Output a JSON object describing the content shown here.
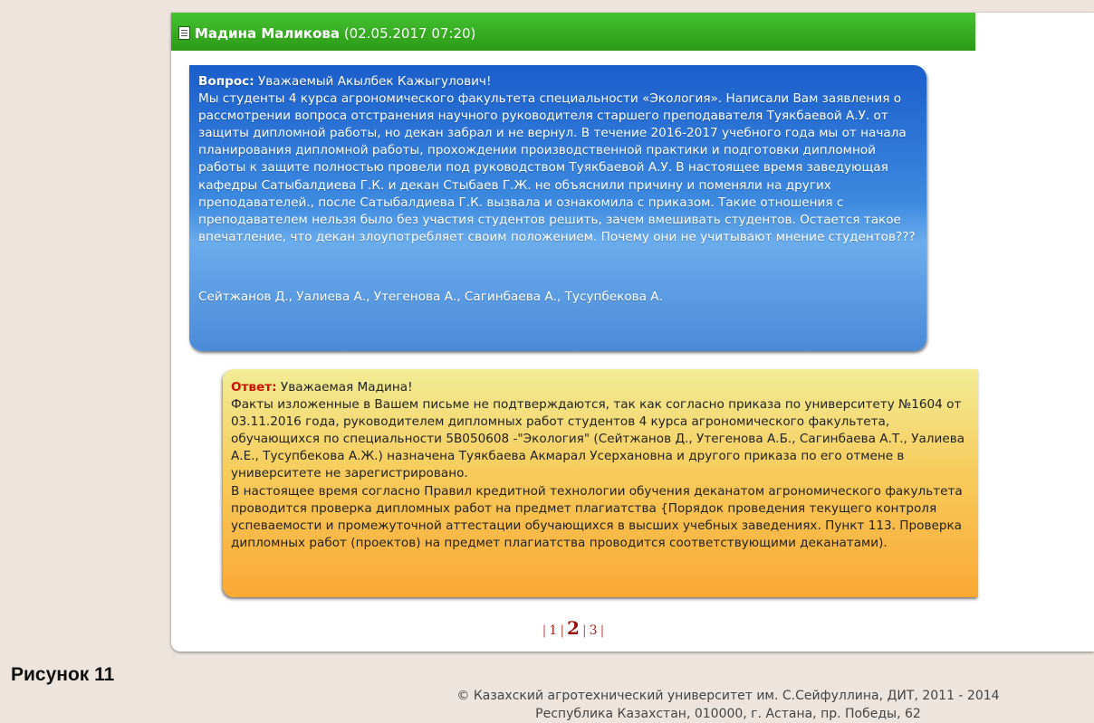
{
  "header": {
    "author": "Мадина Маликова",
    "datetime": "(02.05.2017 07:20)"
  },
  "question": {
    "label": "Вопрос:",
    "greeting": "Уважаемый Акылбек Кажыгулович!",
    "body": "Мы студенты 4 курса агрономического факультета специальности «Экология». Написали Вам заявления о рассмотрении вопроса отстранения научного руководителя старшего преподавателя Туякбаевой А.У. от защиты дипломной работы, но декан забрал и не вернул. В течение 2016-2017 учебного года мы от начала планирования дипломной работы, прохождении производственной практики и подготовки дипломной работы к защите полностью провели под руководством Туякбаевой А.У. В настоящее время заведующая кафедры Сатыбалдиева Г.К. и декан Стыбаев Г.Ж. не объяснили причину и поменяли на других преподавателей., после Сатыбалдиева Г.К. вызвала и ознакомила с приказом. Такие отношения с преподавателем нельзя было без участия студентов решить, зачем вмешивать студентов. Остается такое впечатление, что декан злоупотребляет своим положением. Почему они не учитывают мнение студентов???",
    "signature": "Сейтжанов Д., Уалиева А., Утегенова А., Сагинбаева А., Тусупбекова А."
  },
  "answer": {
    "label": "Ответ:",
    "greeting": "Уважаемая Мадина!",
    "paragraph1": "Факты изложенные в Вашем письме не подтверждаются, так как согласно приказа по университету №1604 от 03.11.2016 года, руководителем дипломных работ студентов 4 курса агрономического факультета, обучающихся по специальности 5В050608 -\"Экология\" (Сейтжанов Д., Утегенова А.Б., Сагинбаева А.Т., Уалиева А.Е., Тусупбекова А.Ж.) назначена Туякбаева Акмарал Усерхановна и другого приказа по его отмене в университете не зарегистрировано.",
    "paragraph2": "В настоящее время согласно Правил кредитной технологии обучения деканатом агрономического факультета проводится проверка дипломных работ на предмет плагиатства {Порядок проведения текущего контроля успеваемости и промежуточной аттестации обучающихся в высших учебных заведениях. Пункт 113. Проверка дипломных работ (проектов) на предмет плагиатства проводится соответствующими деканатами)."
  },
  "pagination": {
    "pages": [
      "1",
      "2",
      "3"
    ],
    "current": "2"
  },
  "caption": "Рисунок 11",
  "footer": {
    "line1": "© Казахский агротехнический университет им. С.Сейфуллина, ДИТ, 2011 - 2014",
    "line2": "Республика Казахстан, 010000, г. Астана, пр. Победы, 62"
  }
}
